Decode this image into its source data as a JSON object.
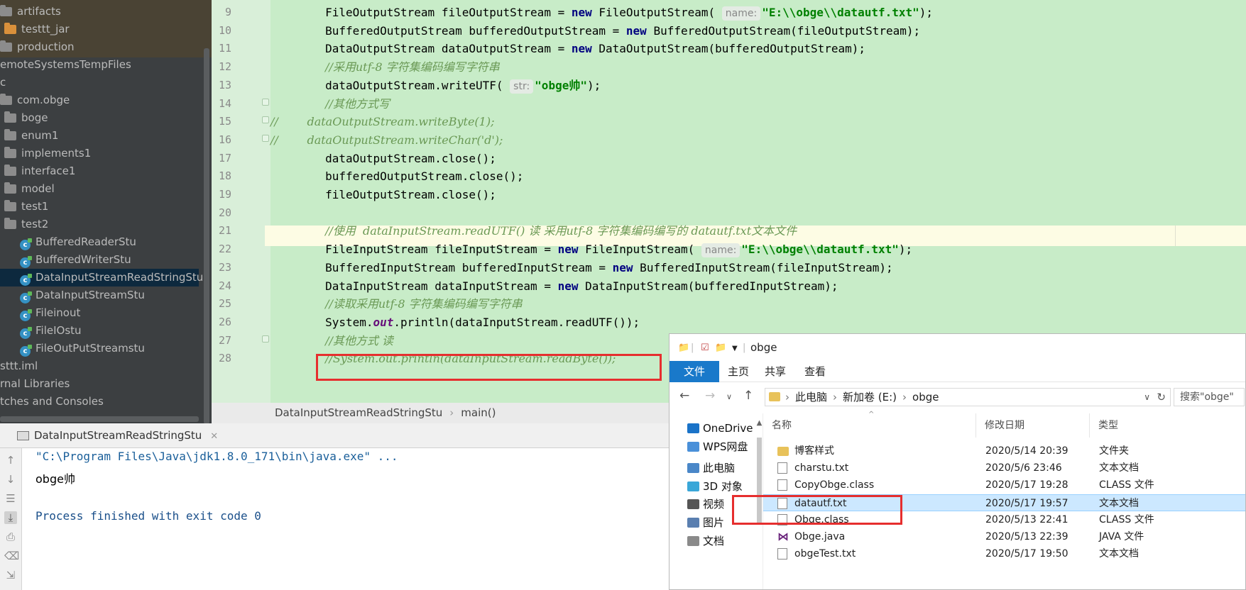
{
  "project_tree": {
    "items": [
      {
        "label": "artifacts",
        "icon": "folder-icon",
        "indent": 0
      },
      {
        "label": "testtt_jar",
        "icon": "folder-icon",
        "indent": 1
      },
      {
        "label": "production",
        "icon": "folder-icon",
        "indent": 0
      },
      {
        "label": "emoteSystemsTempFiles",
        "icon": "none",
        "indent": 0
      },
      {
        "label": "c",
        "icon": "none",
        "indent": 0
      },
      {
        "label": "com.obge",
        "icon": "package-icon",
        "indent": 0
      },
      {
        "label": "boge",
        "icon": "folder-icon",
        "indent": 1
      },
      {
        "label": "enum1",
        "icon": "folder-icon",
        "indent": 1
      },
      {
        "label": "implements1",
        "icon": "folder-icon",
        "indent": 1
      },
      {
        "label": "interface1",
        "icon": "folder-icon",
        "indent": 1
      },
      {
        "label": "model",
        "icon": "folder-icon",
        "indent": 1
      },
      {
        "label": "test1",
        "icon": "folder-icon",
        "indent": 1
      },
      {
        "label": "test2",
        "icon": "folder-icon",
        "indent": 1
      },
      {
        "label": "BufferedReaderStu",
        "icon": "java-class-icon",
        "indent": 2
      },
      {
        "label": "BufferedWriterStu",
        "icon": "java-class-icon",
        "indent": 2
      },
      {
        "label": "DataInputStreamReadStringStu",
        "icon": "java-class-icon",
        "indent": 2,
        "selected": true
      },
      {
        "label": "DataInputStreamStu",
        "icon": "java-class-icon",
        "indent": 2
      },
      {
        "label": "Fileinout",
        "icon": "java-class-icon",
        "indent": 2
      },
      {
        "label": "FileIOstu",
        "icon": "java-class-icon",
        "indent": 2
      },
      {
        "label": "FileOutPutStreamstu",
        "icon": "java-class-icon",
        "indent": 2
      },
      {
        "label": "sttt.iml",
        "icon": "none",
        "indent": 0
      },
      {
        "label": "rnal Libraries",
        "icon": "none",
        "indent": 0
      },
      {
        "label": "tches and Consoles",
        "icon": "none",
        "indent": 0
      }
    ]
  },
  "editor": {
    "lines": [
      {
        "num": "9",
        "text": "        FileOutputStream fileOutputStream = new FileOutputStream( name: \"E:\\\\obge\\\\datautf.txt\");"
      },
      {
        "num": "10",
        "text": "        BufferedOutputStream bufferedOutputStream = new BufferedOutputStream(fileOutputStream);"
      },
      {
        "num": "11",
        "text": "        DataOutputStream dataOutputStream = new DataOutputStream(bufferedOutputStream);"
      },
      {
        "num": "12",
        "text": "        //采用utf-8 字符集编码编写字符串"
      },
      {
        "num": "13",
        "text": "        dataOutputStream.writeUTF( str: \"obge帅\");"
      },
      {
        "num": "14",
        "text": "        //其他方式写"
      },
      {
        "num": "15",
        "text": "//        dataOutputStream.writeByte(1);"
      },
      {
        "num": "16",
        "text": "//        dataOutputStream.writeChar('d');"
      },
      {
        "num": "17",
        "text": "        dataOutputStream.close();"
      },
      {
        "num": "18",
        "text": "        bufferedOutputStream.close();"
      },
      {
        "num": "19",
        "text": "        fileOutputStream.close();"
      },
      {
        "num": "20",
        "text": ""
      },
      {
        "num": "21",
        "text": "        //使用  dataInputStream.readUTF() 读 采用utf-8 字符集编码编写的 datautf.txt文本文件"
      },
      {
        "num": "22",
        "text": "        FileInputStream fileInputStream = new FileInputStream( name: \"E:\\\\obge\\\\datautf.txt\");"
      },
      {
        "num": "23",
        "text": "        BufferedInputStream bufferedInputStream = new BufferedInputStream(fileInputStream);"
      },
      {
        "num": "24",
        "text": "        DataInputStream dataInputStream = new DataInputStream(bufferedInputStream);"
      },
      {
        "num": "25",
        "text": "        //读取采用utf-8 字符集编码编写字符串"
      },
      {
        "num": "26",
        "text": "        System.out.println(dataInputStream.readUTF());"
      },
      {
        "num": "27",
        "text": "        //其他方式 读"
      },
      {
        "num": "28",
        "text": "        //System.out.println(dataInputStream.readByte());"
      }
    ],
    "breadcrumb": {
      "class": "DataInputStreamReadStringStu",
      "method": "main()"
    }
  },
  "run_panel": {
    "tab_label": "DataInputStreamReadStringStu",
    "console": [
      "\"C:\\Program Files\\Java\\jdk1.8.0_171\\bin\\java.exe\" ...",
      "obge帅",
      "",
      "Process finished with exit code 0"
    ],
    "colors": {
      "command": "#1a5f9a",
      "output": "#000000"
    }
  },
  "explorer": {
    "title": "obge",
    "ribbon_tabs": [
      "文件",
      "主页",
      "共享",
      "查看"
    ],
    "address": [
      "此电脑",
      "新加卷 (E:)",
      "obge"
    ],
    "search_placeholder": "搜索\"obge\"",
    "nav_items": [
      "OneDrive",
      "WPS网盘",
      "此电脑",
      "3D 对象",
      "视频",
      "图片",
      "文档"
    ],
    "columns": [
      "名称",
      "修改日期",
      "类型"
    ],
    "files": [
      {
        "name": "博客样式",
        "date": "2020/5/14 20:39",
        "type": "文件夹",
        "icon": "folder-icon"
      },
      {
        "name": "charstu.txt",
        "date": "2020/5/6 23:46",
        "type": "文本文档",
        "icon": "text-file-icon"
      },
      {
        "name": "CopyObge.class",
        "date": "2020/5/17 19:28",
        "type": "CLASS 文件",
        "icon": "file-icon"
      },
      {
        "name": "datautf.txt",
        "date": "2020/5/17 19:57",
        "type": "文本文档",
        "icon": "text-file-icon",
        "selected": true
      },
      {
        "name": "Obge.class",
        "date": "2020/5/13 22:41",
        "type": "CLASS 文件",
        "icon": "file-icon"
      },
      {
        "name": "Obge.java",
        "date": "2020/5/13 22:39",
        "type": "JAVA 文件",
        "icon": "visual-studio-icon"
      },
      {
        "name": "obgeTest.txt",
        "date": "2020/5/17 19:50",
        "type": "文本文档",
        "icon": "text-file-icon"
      }
    ]
  },
  "highlight_color": "#e62e2e"
}
